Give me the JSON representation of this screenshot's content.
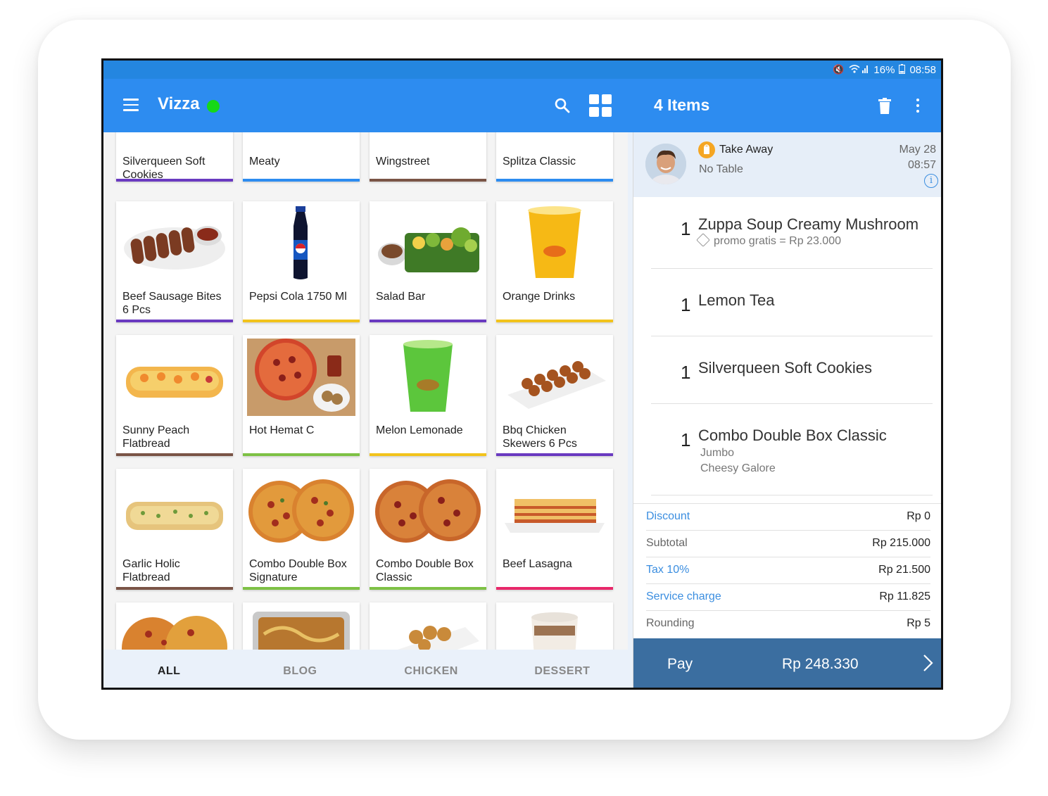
{
  "status_bar": {
    "battery": "16%",
    "time": "08:58"
  },
  "app_bar": {
    "title": "Vizza",
    "order_count_title": "4 Items"
  },
  "products": [
    {
      "name": "Silverqueen Soft Cookies",
      "bar_color": "#6a3ac0"
    },
    {
      "name": "Meaty",
      "bar_color": "#2d8cf0"
    },
    {
      "name": "Wingstreet",
      "bar_color": "#7a5446"
    },
    {
      "name": "Splitza Classic",
      "bar_color": "#2d8cf0"
    },
    {
      "name": "Beef Sausage Bites 6 Pcs",
      "bar_color": "#6a3ac0"
    },
    {
      "name": "Pepsi Cola 1750 Ml",
      "bar_color": "#f2c31c"
    },
    {
      "name": "Salad Bar",
      "bar_color": "#6a3ac0"
    },
    {
      "name": "Orange Drinks",
      "bar_color": "#f2c31c"
    },
    {
      "name": "Sunny Peach Flatbread",
      "bar_color": "#7a5446"
    },
    {
      "name": "Hot Hemat C",
      "bar_color": "#7ec145"
    },
    {
      "name": "Melon Lemonade",
      "bar_color": "#f2c31c"
    },
    {
      "name": "Bbq Chicken Skewers 6 Pcs",
      "bar_color": "#6a3ac0"
    },
    {
      "name": "Garlic Holic Flatbread",
      "bar_color": "#7a5446"
    },
    {
      "name": "Combo Double Box Signature",
      "bar_color": "#7ec145"
    },
    {
      "name": "Combo Double Box Classic",
      "bar_color": "#7ec145"
    },
    {
      "name": "Beef Lasagna",
      "bar_color": "#e8286a"
    }
  ],
  "category_tabs": [
    "ALL",
    "BLOG",
    "CHICKEN",
    "DESSERT"
  ],
  "order": {
    "type": "Take Away",
    "table": "No Table",
    "date": "May 28",
    "time": "08:57",
    "info": "i",
    "items": [
      {
        "qty": "1",
        "name": "Zuppa Soup Creamy Mushroom",
        "notes": [
          "promo gratis = Rp 23.000"
        ]
      },
      {
        "qty": "1",
        "name": "Lemon Tea",
        "notes": []
      },
      {
        "qty": "1",
        "name": "Silverqueen Soft Cookies",
        "notes": []
      },
      {
        "qty": "1",
        "name": "Combo Double Box Classic",
        "notes": [
          "Jumbo",
          "Cheesy Galore"
        ]
      }
    ],
    "summary": [
      {
        "label": "Discount",
        "value": "Rp 0",
        "link": true
      },
      {
        "label": "Subtotal",
        "value": "Rp 215.000",
        "link": false
      },
      {
        "label": "Tax 10%",
        "value": "Rp 21.500",
        "link": true
      },
      {
        "label": "Service charge",
        "value": "Rp 11.825",
        "link": true
      },
      {
        "label": "Rounding",
        "value": "Rp 5",
        "link": false
      }
    ],
    "pay_label": "Pay",
    "total": "Rp 248.330"
  },
  "colors": {
    "appbar": "#2d8cf0",
    "statusbar": "#2486e0",
    "pay_bar": "#3b6ea0",
    "online": "#16d816"
  }
}
